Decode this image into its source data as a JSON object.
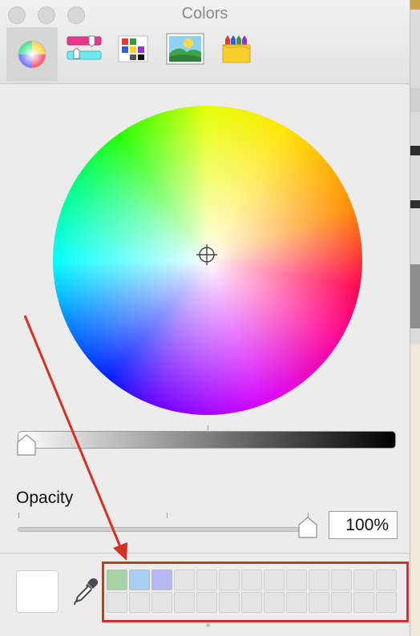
{
  "window": {
    "title": "Colors"
  },
  "toolbar": {
    "tools": [
      {
        "icon": "color-wheel-icon",
        "selected": true
      },
      {
        "icon": "color-sliders-icon",
        "selected": false
      },
      {
        "icon": "color-palettes-icon",
        "selected": false
      },
      {
        "icon": "image-palettes-icon",
        "selected": false
      },
      {
        "icon": "crayons-icon",
        "selected": false
      }
    ]
  },
  "brightness": {
    "level": 0.0
  },
  "opacity": {
    "label": "Opacity",
    "value_text": "100%",
    "level": 1.0
  },
  "current_color": "#ffffff",
  "swatches": {
    "colors": [
      "#a7d3a2",
      "#a8cff6",
      "#b7b7f4"
    ],
    "total_cells": 26
  },
  "annotation": {
    "color": "#d93025"
  }
}
